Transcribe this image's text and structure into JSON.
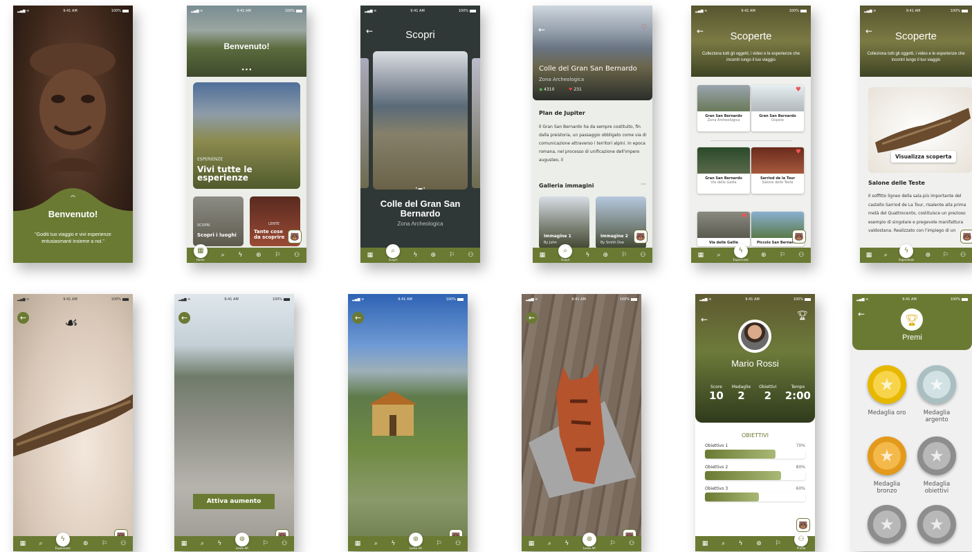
{
  "status": {
    "time": "9:41 AM",
    "battery": "100%"
  },
  "nav": {
    "home": "Home",
    "scopri": "Scopri",
    "esperienze": "Esperienze",
    "lente": "Lente AR",
    "profilo": "Profilo"
  },
  "s1": {
    "title": "Benvenuto!",
    "quote": "\"Goditi tuo viaggio e vivi esperienze entusiasmanti insieme a noi.\""
  },
  "s2": {
    "hero": "Benvenuto!",
    "tag": "ESPERIENZE",
    "big": "Vivi tutte le esperienze",
    "c1tag": "SCOPRI",
    "c1": "Scopri i luoghi",
    "c2tag": "LENTE",
    "c2": "Tante cose da scoprire"
  },
  "s3": {
    "title": "Scopri",
    "place": "Colle del Gran San Bernardo",
    "sub": "Zona Archeologica"
  },
  "s4": {
    "place": "Colle del Gran San Bernardo",
    "sub": "Zona Archeologica",
    "views": "4310",
    "likes": "231",
    "h": "Plan de Jupiter",
    "body": "Il Gran San Bernardo ha da sempre costituito, fin dalla preistoria, un passaggio obbligato come via di comunicazione attraverso i territori alpini. In epoca romana, nel processo di unificazione dell'impero augusteo, il",
    "gal": "Galleria immagini",
    "more": "···",
    "img1": "Immagine 1",
    "img1b": "By John",
    "img2": "Immagine 2",
    "img2b": "By Smith Doe"
  },
  "s5": {
    "title": "Scoperte",
    "sub": "Colleziona tutti gli oggetti, i video e le esperienze che incontri lungo il tuo viaggio",
    "cards": [
      {
        "t": "Gran San Bernardo",
        "s": "Zona Archeologica"
      },
      {
        "t": "Gran San Bernardo",
        "s": "Ospizio"
      },
      {
        "t": "Gran San Bernardo",
        "s": "Via delle Gallie"
      },
      {
        "t": "Sarriod de la Tour",
        "s": "Salone delle Teste"
      },
      {
        "t": "Via delle Gallie",
        "s": ""
      },
      {
        "t": "Piccolo San Bernardo",
        "s": ""
      }
    ]
  },
  "s6": {
    "title": "Scoperte",
    "sub": "Colleziona tutti gli oggetti, i video e le esperienze che incontri lungo il tuo viaggio",
    "btn": "Visualizza scoperta",
    "h": "Salone delle Teste",
    "body": "Il soffitto ligneo della sala più importante del castello Sarriod de La Tour, risalente alla prima metà del Quattrocento, costituisce un prezioso esempio di singolare e pregevole manifattura valdostana. Realizzato con l'impiego di un"
  },
  "s8": {
    "btn": "Attiva aumento"
  },
  "s11": {
    "name": "Mario Rossi",
    "stats": [
      {
        "l": "Score",
        "v": "10"
      },
      {
        "l": "Medaglie",
        "v": "2"
      },
      {
        "l": "Obiettivi",
        "v": "2"
      },
      {
        "l": "Tempo",
        "v": "2:00"
      }
    ],
    "h": "OBIETTIVI",
    "goals": [
      {
        "l": "Obiettivo 1",
        "p": "70%",
        "v": 0.7
      },
      {
        "l": "Obiettivo 2",
        "p": "80%",
        "v": 0.76
      },
      {
        "l": "Obiettivo 3",
        "p": "60%",
        "v": 0.54
      }
    ]
  },
  "s12": {
    "title": "Premi",
    "medals": [
      "Medaglia oro",
      "Medaglia argento",
      "Medaglia bronzo",
      "Medaglia obiettivi"
    ]
  },
  "colors": {
    "olive": "#6b7a33",
    "dark": "#2f3836"
  }
}
